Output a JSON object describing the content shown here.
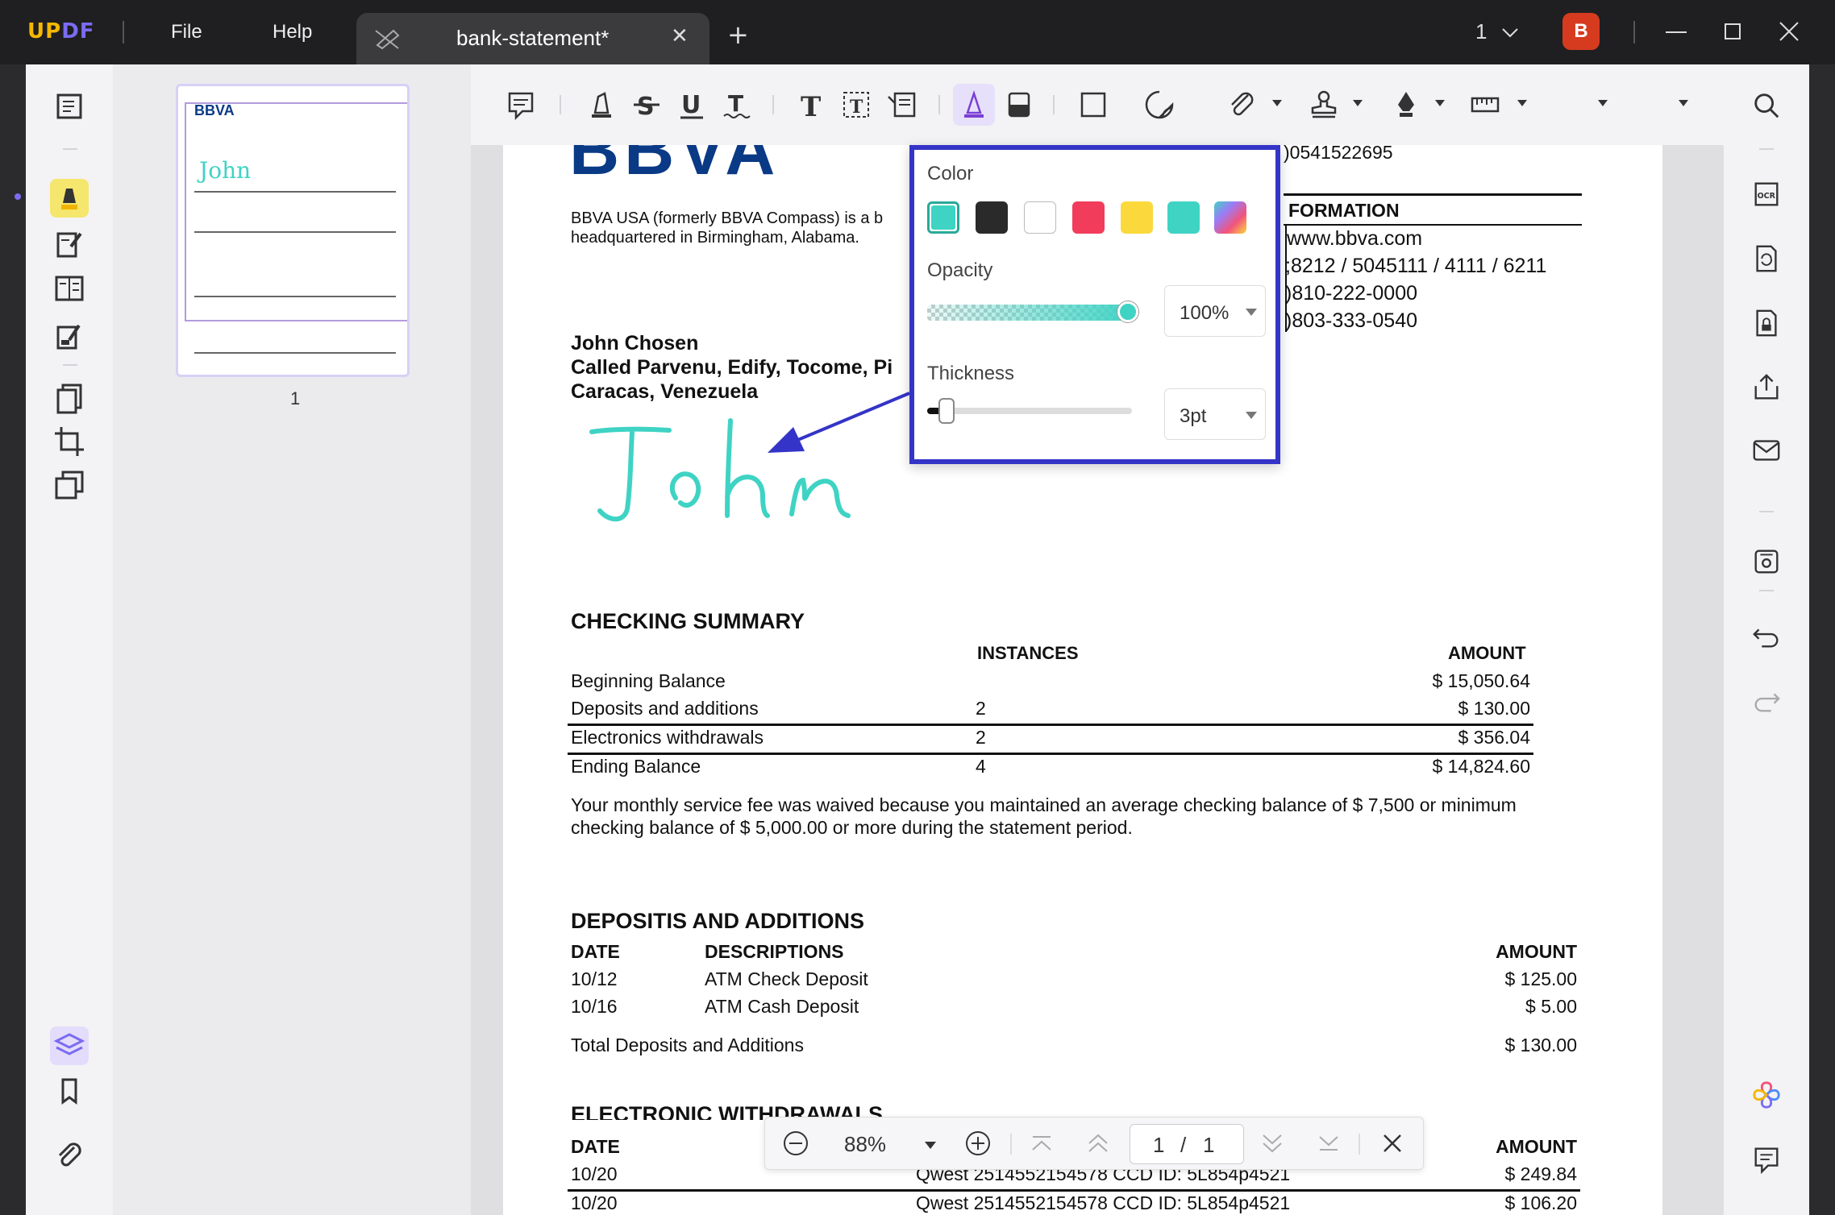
{
  "app": {
    "logo": "UPDF",
    "menu_file": "File",
    "menu_help": "Help",
    "tab_title": "bank-statement*",
    "tab_close": "✕",
    "new_tab": "+",
    "page_selector": "1",
    "avatar_letter": "B"
  },
  "thumbnail": {
    "page_number": "1"
  },
  "document": {
    "bank_logo": "BBVA",
    "account_partial": ")0541522695",
    "bank_desc_1": "BBVA USA (formerly BBVA Compass) is a b",
    "bank_desc_2": "headquartered in Birmingham, Alabama.",
    "info_heading": "FORMATION",
    "website": "www.bbva.com",
    "phone_1": ";8212 / 5045111 / 4111 / 6211",
    "phone_2": ")810-222-0000",
    "phone_3": ")803-333-0540",
    "customer_name": "John Chosen",
    "customer_addr_1": "Called Parvenu, Edify, Tocome, Pi",
    "customer_addr_2": "Caracas, Venezuela",
    "signature": "John",
    "checking_title": "CHECKING SUMMARY",
    "checking_headers": {
      "instances": "INSTANCES",
      "amount": "AMOUNT"
    },
    "checking_rows": [
      {
        "label": "Beginning Balance",
        "instances": "",
        "amount": "$ 15,050.64"
      },
      {
        "label": "Deposits and additions",
        "instances": "2",
        "amount": "$ 130.00"
      },
      {
        "label": "Electronics withdrawals",
        "instances": "2",
        "amount": "$ 356.04"
      },
      {
        "label": "Ending Balance",
        "instances": "4",
        "amount": "$ 14,824.60"
      }
    ],
    "fee_note_1": "Your monthly service fee was waived because you maintained an average checking balance of $ 7,500 or minimum",
    "fee_note_2": "checking balance of $ 5,000.00 or more during the statement period.",
    "deposits_title": "DEPOSITIS AND ADDITIONS",
    "deposits_headers": {
      "date": "DATE",
      "desc": "DESCRIPTIONS",
      "amount": "AMOUNT"
    },
    "deposits_rows": [
      {
        "date": "10/12",
        "desc": "ATM Check Deposit",
        "amount": "$ 125.00"
      },
      {
        "date": "10/16",
        "desc": "ATM Cash Deposit",
        "amount": "$ 5.00"
      }
    ],
    "deposits_total_label": "Total Deposits and Additions",
    "deposits_total": "$ 130.00",
    "withdrawals_title": "ELECTRONIC WITHDRAWALS",
    "withdrawals_headers": {
      "date": "DATE",
      "amount": "AMOUNT"
    },
    "withdrawals_rows": [
      {
        "date": "10/20",
        "desc": "Qwest 2514552154578 CCD ID: 5L854p4521",
        "amount": "$ 249.84"
      },
      {
        "date": "10/20",
        "desc": "Qwest 2514552154578 CCD ID: 5L854p4521",
        "amount": "$ 106.20"
      }
    ]
  },
  "popup": {
    "color_label": "Color",
    "colors": [
      "#3fd3c4",
      "#2a2a2a",
      "#ffffff",
      "#f23c5c",
      "#fbd93c",
      "#3fd3c4",
      "rainbow"
    ],
    "selected_color": "#3fd3c4",
    "opacity_label": "Opacity",
    "opacity_value": "100%",
    "opacity_level": 1.0,
    "thickness_label": "Thickness",
    "thickness_value": "3pt",
    "thickness_level": 0.05
  },
  "zoombar": {
    "zoom": "88%",
    "page_current": "1",
    "page_sep": "/",
    "page_total": "1"
  }
}
